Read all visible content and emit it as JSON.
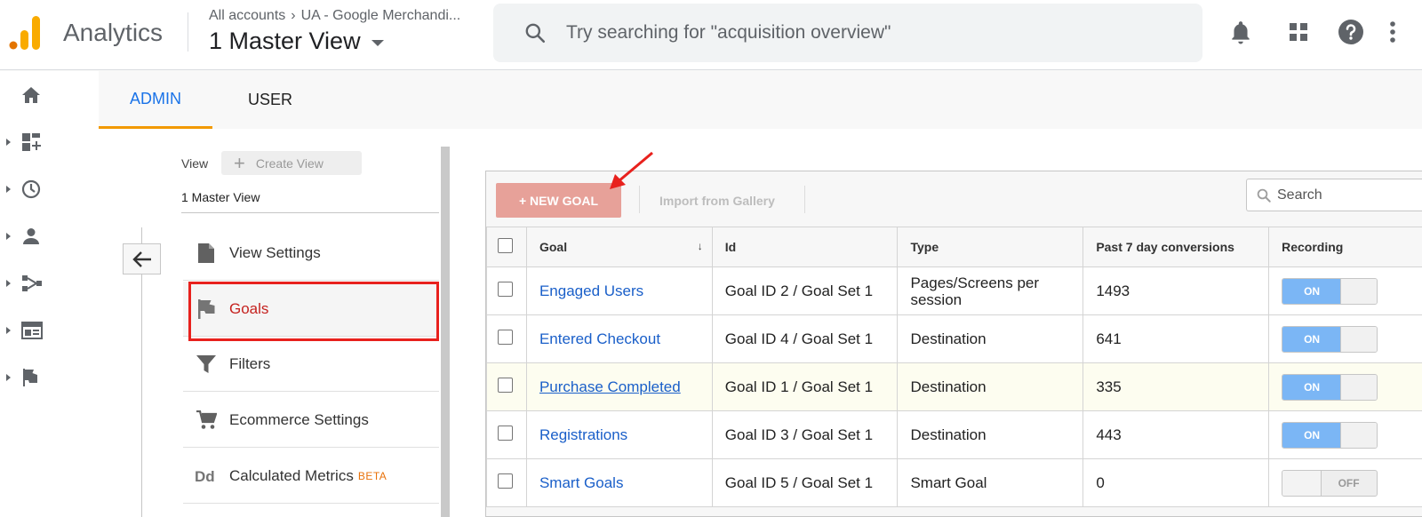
{
  "header": {
    "app_name": "Analytics",
    "breadcrumb": [
      "All accounts",
      "UA - Google Merchandi..."
    ],
    "breadcrumb_separator": "›",
    "view_selector": "1 Master View",
    "search_placeholder": "Try searching for \"acquisition overview\"",
    "icons": [
      "notifications-icon",
      "apps-grid-icon",
      "help-icon",
      "more-vert-icon"
    ],
    "logo_colors": [
      "#f9ab00",
      "#e37400"
    ]
  },
  "left_nav": {
    "icons": [
      "home-icon",
      "customization-icon",
      "realtime-icon",
      "audience-icon",
      "acquisition-icon",
      "behavior-icon",
      "conversions-icon"
    ]
  },
  "tabs": [
    {
      "label": "ADMIN",
      "active": true
    },
    {
      "label": "USER",
      "active": false
    }
  ],
  "view_column": {
    "label": "View",
    "create_button": "Create View",
    "selected_view": "1 Master View",
    "items": [
      {
        "label": "View Settings",
        "icon": "document-icon",
        "active": false
      },
      {
        "label": "Goals",
        "icon": "flag-icon",
        "active": true
      },
      {
        "label": "Filters",
        "icon": "filter-icon",
        "active": false
      },
      {
        "label": "Ecommerce Settings",
        "icon": "cart-icon",
        "active": false
      },
      {
        "label": "Calculated Metrics",
        "badge": "BETA",
        "icon": "dd-icon",
        "active": false
      }
    ]
  },
  "goals_panel": {
    "new_goal_button": "+ NEW GOAL",
    "import_button": "Import from Gallery",
    "search_placeholder": "Search",
    "columns": [
      "Goal",
      "Id",
      "Type",
      "Past 7 day conversions",
      "Recording"
    ],
    "sort_indicator": "↓",
    "rows": [
      {
        "goal": "Engaged Users",
        "id": "Goal ID 2 / Goal Set 1",
        "type": "Pages/Screens per session",
        "conversions": "1493",
        "recording": "ON"
      },
      {
        "goal": "Entered Checkout",
        "id": "Goal ID 4 / Goal Set 1",
        "type": "Destination",
        "conversions": "641",
        "recording": "ON"
      },
      {
        "goal": "Purchase Completed",
        "id": "Goal ID 1 / Goal Set 1",
        "type": "Destination",
        "conversions": "335",
        "recording": "ON"
      },
      {
        "goal": "Registrations",
        "id": "Goal ID 3 / Goal Set 1",
        "type": "Destination",
        "conversions": "443",
        "recording": "ON"
      },
      {
        "goal": "Smart Goals",
        "id": "Goal ID 5 / Goal Set 1",
        "type": "Smart Goal",
        "conversions": "0",
        "recording": "OFF"
      }
    ]
  },
  "colors": {
    "accent_blue": "#1a73e8",
    "tab_underline": "#f29900",
    "highlight_box": "#e8211d",
    "new_goal_bg": "#e7a199",
    "toggle_on": "#7bb6f5"
  }
}
